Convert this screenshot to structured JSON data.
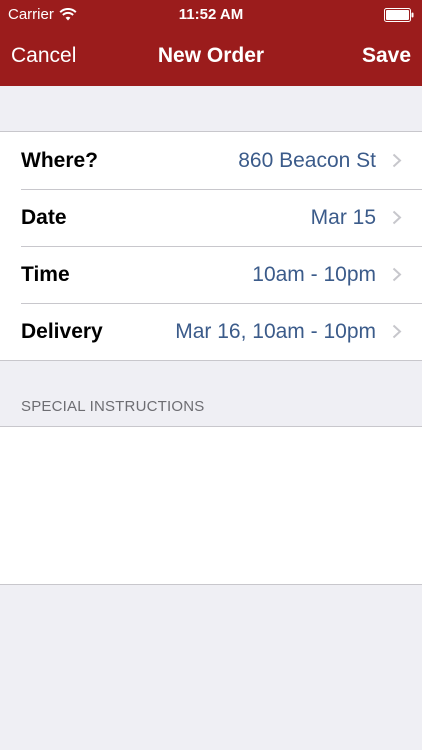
{
  "status_bar": {
    "carrier": "Carrier",
    "time": "11:52 AM",
    "icons": [
      "wifi-icon",
      "battery-icon"
    ]
  },
  "nav": {
    "left_label": "Cancel",
    "title": "New Order",
    "right_label": "Save"
  },
  "rows": [
    {
      "label": "Where?",
      "value": "860 Beacon St"
    },
    {
      "label": "Date",
      "value": "Mar 15"
    },
    {
      "label": "Time",
      "value": "10am - 10pm"
    },
    {
      "label": "Delivery",
      "value": "Mar 16, 10am - 10pm"
    }
  ],
  "special_instructions": {
    "header": "SPECIAL INSTRUCTIONS",
    "value": ""
  },
  "colors": {
    "nav_background": "#9b1c1c",
    "value_text": "#3b5b8a",
    "page_background": "#efeff4"
  }
}
